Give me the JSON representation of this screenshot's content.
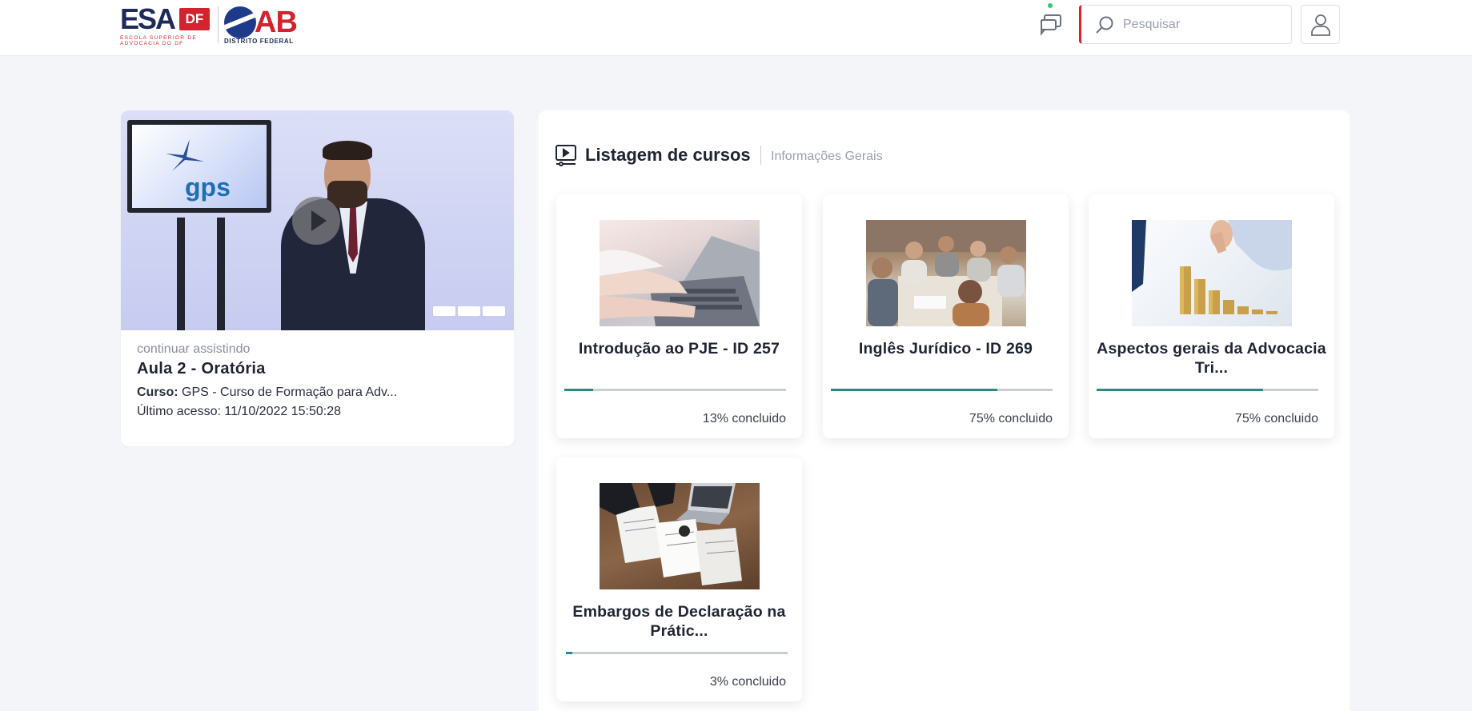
{
  "header": {
    "esa_logo_text": "ESA",
    "esa_logo_badge": "DF",
    "esa_logo_sub": "ESCOLA SUPERIOR DE ADVOCACIA DO DF",
    "oab_logo_text": "AB",
    "oab_logo_sub": "DISTRITO FEDERAL",
    "search_placeholder": "Pesquisar",
    "online_dot_color": "#2ecc71"
  },
  "continue_watching": {
    "label": "continuar assistindo",
    "lesson_title": "Aula 2 - Oratória",
    "course_label": "Curso:",
    "course_name": "GPS - Curso de Formação para Adv...",
    "last_access": "Último acesso: 11/10/2022 15:50:28",
    "thumbnail_text": "gps"
  },
  "courses_panel": {
    "title": "Listagem de cursos",
    "subtitle": "Informações Gerais",
    "courses": [
      {
        "name": "Introdução ao PJE - ID 257",
        "progress": 13,
        "progress_label": "13% concluido"
      },
      {
        "name": "Inglês Jurídico - ID 269",
        "progress": 75,
        "progress_label": "75% concluido"
      },
      {
        "name": "Aspectos gerais da Advocacia Tri...",
        "progress": 75,
        "progress_label": "75% concluido"
      },
      {
        "name": "Embargos de Declaração na Prátic...",
        "progress": 3,
        "progress_label": "3% concluido"
      }
    ]
  },
  "colors": {
    "accent_red": "#d3232e",
    "progress_teal": "#2a8a82",
    "brand_navy": "#1e2a5a"
  }
}
